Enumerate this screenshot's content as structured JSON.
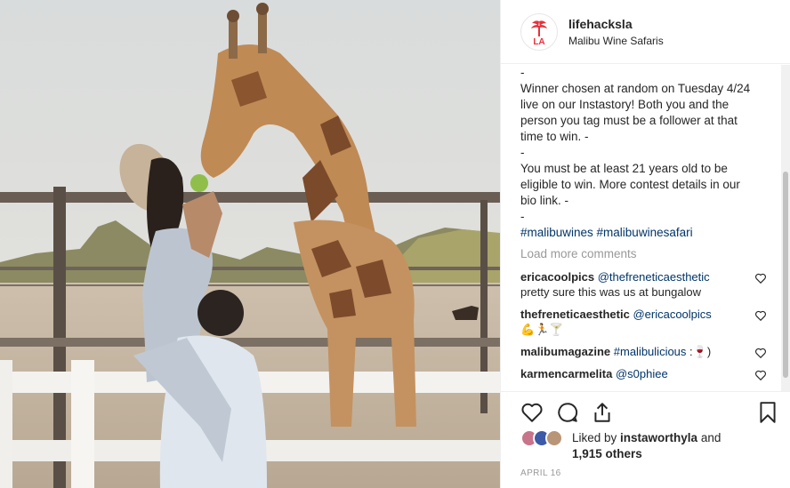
{
  "post": {
    "username": "lifehacksla",
    "location": "Malibu Wine Safaris",
    "avatar_text": "LA",
    "brand_color": "#e8303a"
  },
  "caption": {
    "lines": [
      "-",
      "Winner chosen at random on Tuesday 4/24",
      "live on our Instastory! Both you and the",
      "person you tag must be a follower at that",
      "time to win. -",
      "-",
      "You must be at least 21 years old to be",
      "eligible to win. More contest details in our",
      "bio link. -",
      "-"
    ],
    "hashtags": "#malibuwines #malibuwinesafari"
  },
  "load_more": "Load more comments",
  "comments": [
    {
      "user": "ericacoolpics",
      "mention": "@thefreneticaesthetic",
      "text": "pretty sure this was us at bungalow"
    },
    {
      "user": "thefreneticaesthetic",
      "mention": "@ericacoolpics",
      "text": "💪🏃🍸"
    },
    {
      "user": "malibumagazine",
      "mention": "#malibulicious",
      "text": ":🍷)"
    },
    {
      "user": "karmencarmelita",
      "mention": "@s0phiee",
      "text": ""
    }
  ],
  "likes": {
    "prefix": "Liked by ",
    "user": "instaworthyla",
    "suffix": " and",
    "others": "1,915 others"
  },
  "date": "APRIL 16",
  "icons": {
    "like": "heart-icon",
    "comment": "comment-icon",
    "share": "share-icon",
    "save": "bookmark-icon"
  }
}
